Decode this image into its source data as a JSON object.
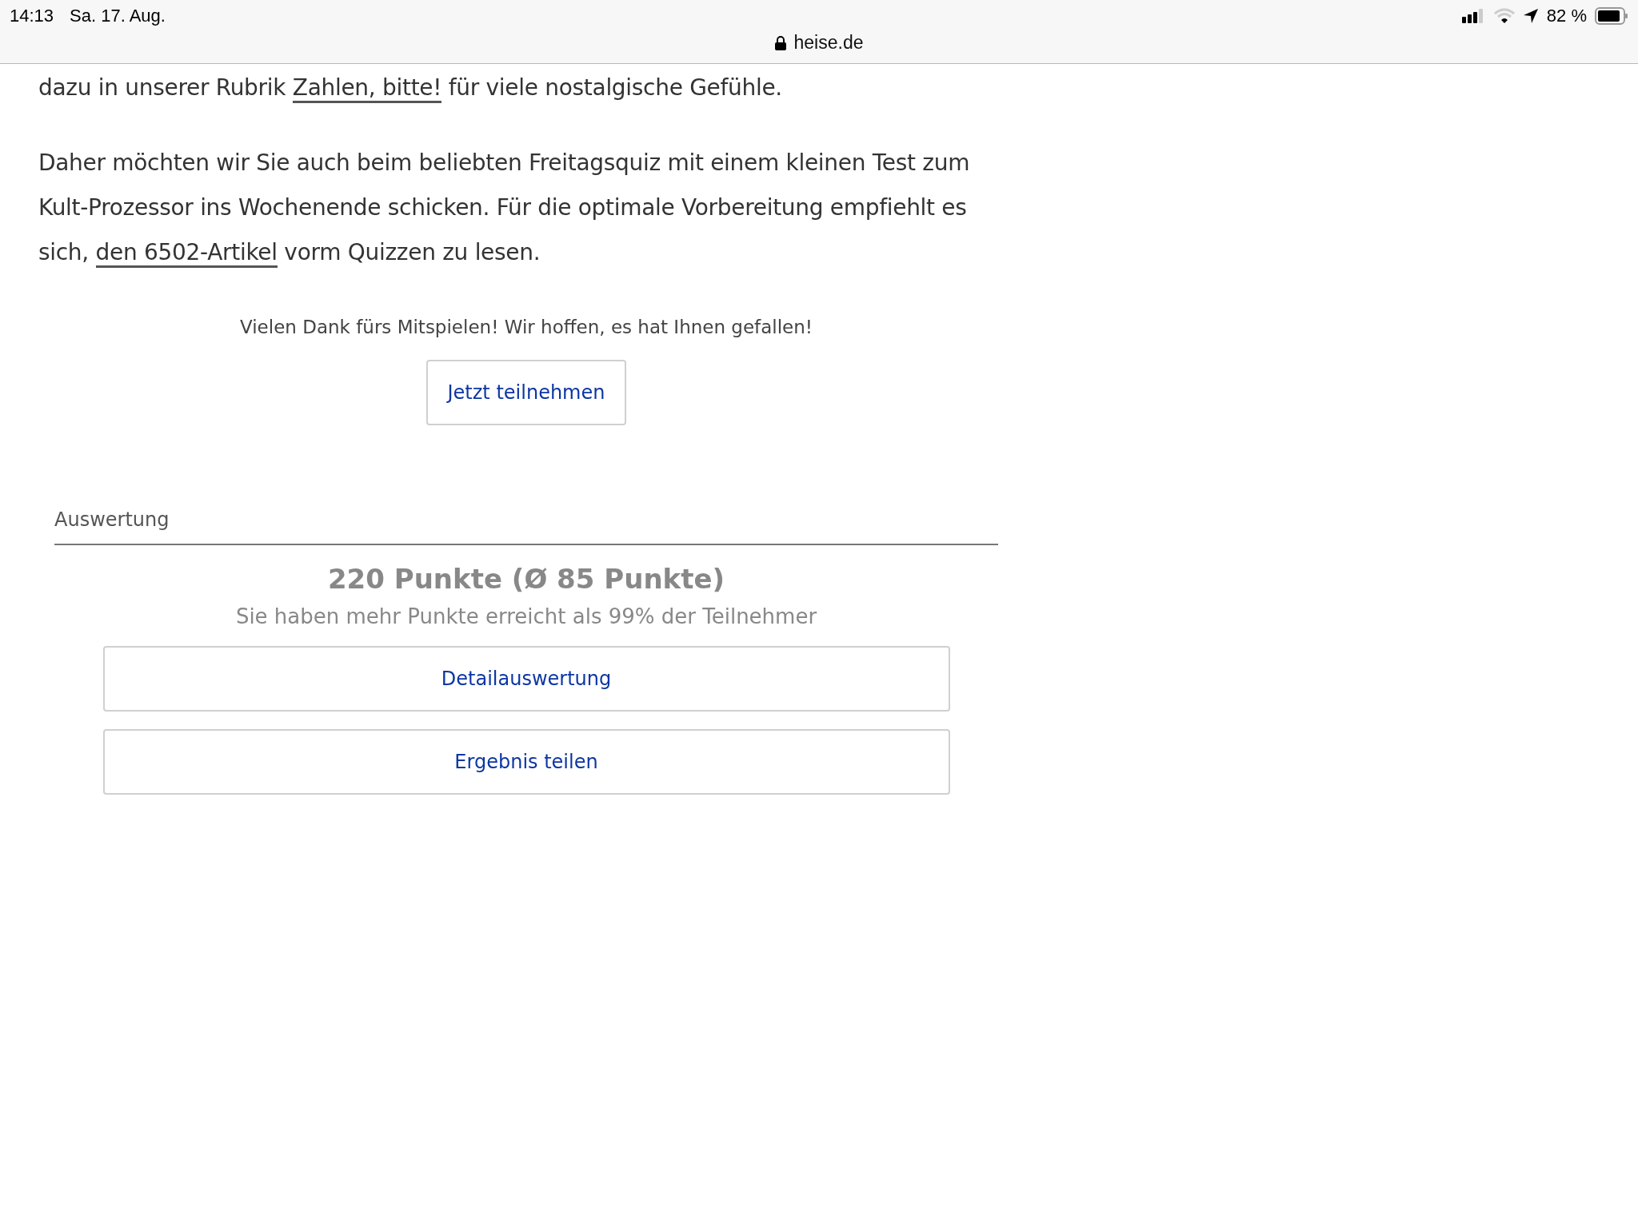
{
  "status_bar": {
    "time": "14:13",
    "date": "Sa. 17. Aug.",
    "url": "heise.de",
    "battery": "82 %"
  },
  "article": {
    "paragraphs": [
      [
        {
          "kind": "text",
          "text": "dazu in unserer Rubrik "
        },
        {
          "kind": "link",
          "text": "Zahlen, bitte!"
        },
        {
          "kind": "text",
          "text": " für viele nostalgische Gefühle."
        }
      ],
      [
        {
          "kind": "text",
          "text": "Daher möchten wir Sie auch beim beliebten Freitagsquiz mit einem kleinen Test zum Kult-Prozessor ins Wochenende schicken. Für die optimale Vorbereitung empfiehlt es sich, "
        },
        {
          "kind": "link",
          "text": "den 6502-Artikel"
        },
        {
          "kind": "text",
          "text": " vorm Quizzen zu lesen."
        }
      ]
    ]
  },
  "quiz": {
    "thanks": "Vielen Dank fürs Mitspielen! Wir hoffen, es hat Ihnen gefallen!",
    "button": "Jetzt teilnehmen",
    "evaluation": {
      "heading": "Auswertung",
      "score": "220 Punkte (Ø 85 Punkte)",
      "summary": "Sie haben mehr Punkte erreicht als 99% der Teilnehmer",
      "buttons": [
        "Detailauswertung",
        "Ergebnis teilen"
      ]
    }
  }
}
